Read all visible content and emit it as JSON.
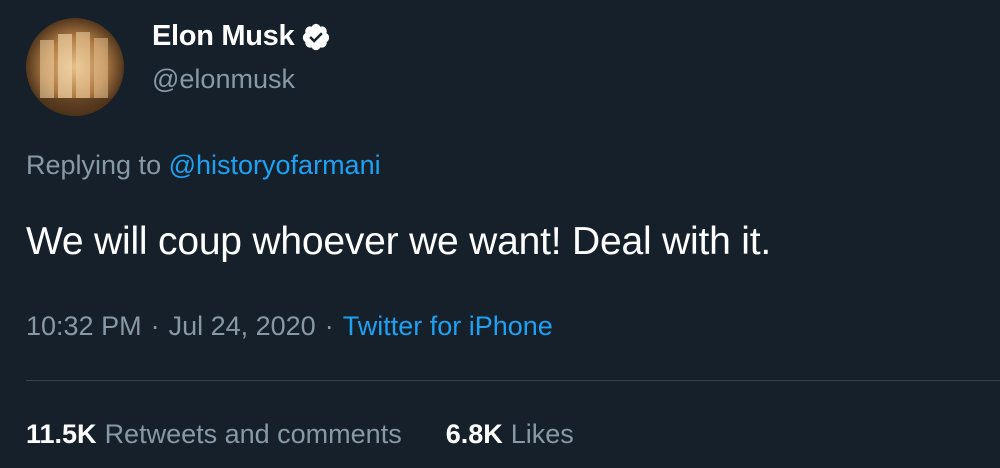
{
  "tweet": {
    "author": {
      "display_name": "Elon Musk",
      "handle": "@elonmusk",
      "verified_icon": "verified-badge-icon",
      "avatar_icon": "avatar-photo"
    },
    "replying_prefix": "Replying to",
    "replying_to": "@historyofarmani",
    "text": "We will coup whoever we want! Deal with it.",
    "time": "10:32 PM",
    "separator": "·",
    "date": "Jul 24, 2020",
    "source": "Twitter for iPhone",
    "stats": {
      "retweets_count": "11.5K",
      "retweets_label": "Retweets and comments",
      "likes_count": "6.8K",
      "likes_label": "Likes"
    }
  },
  "colors": {
    "background": "#15202b",
    "text_primary": "#ffffff",
    "text_secondary": "#8899a6",
    "link": "#1da1f2",
    "divider": "#38444d"
  }
}
